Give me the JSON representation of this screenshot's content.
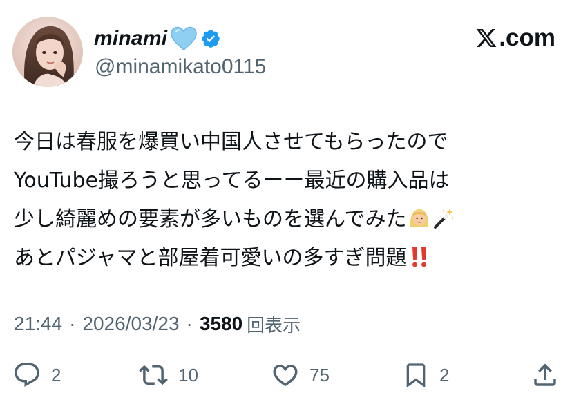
{
  "user": {
    "display_name": "minami",
    "handle": "@minamikato0115"
  },
  "brand": {
    "label": ".com"
  },
  "tweet": {
    "lines": [
      "今日は春服を爆買い中国人させてもらったので",
      "YouTube撮ろうと思ってるーー最近の購入品は",
      "少し綺麗めの要素が多いものを選んでみた",
      "あとパジャマと部屋着可愛いの多すぎ問題"
    ],
    "emojis": [
      "person-blond-hair-emoji",
      "magic-wand-emoji",
      "double-exclamation-emoji"
    ]
  },
  "meta": {
    "time": "21:44",
    "date": "2026/03/23",
    "separator": "·",
    "views_count": "3580",
    "views_label": "回表示"
  },
  "actions": {
    "replies": "2",
    "reposts": "10",
    "likes": "75",
    "bookmarks": "2"
  },
  "colors": {
    "text": "#0f1419",
    "secondary": "#536471",
    "verified": "#1d9bf0",
    "heart": "#7ec8f0"
  }
}
